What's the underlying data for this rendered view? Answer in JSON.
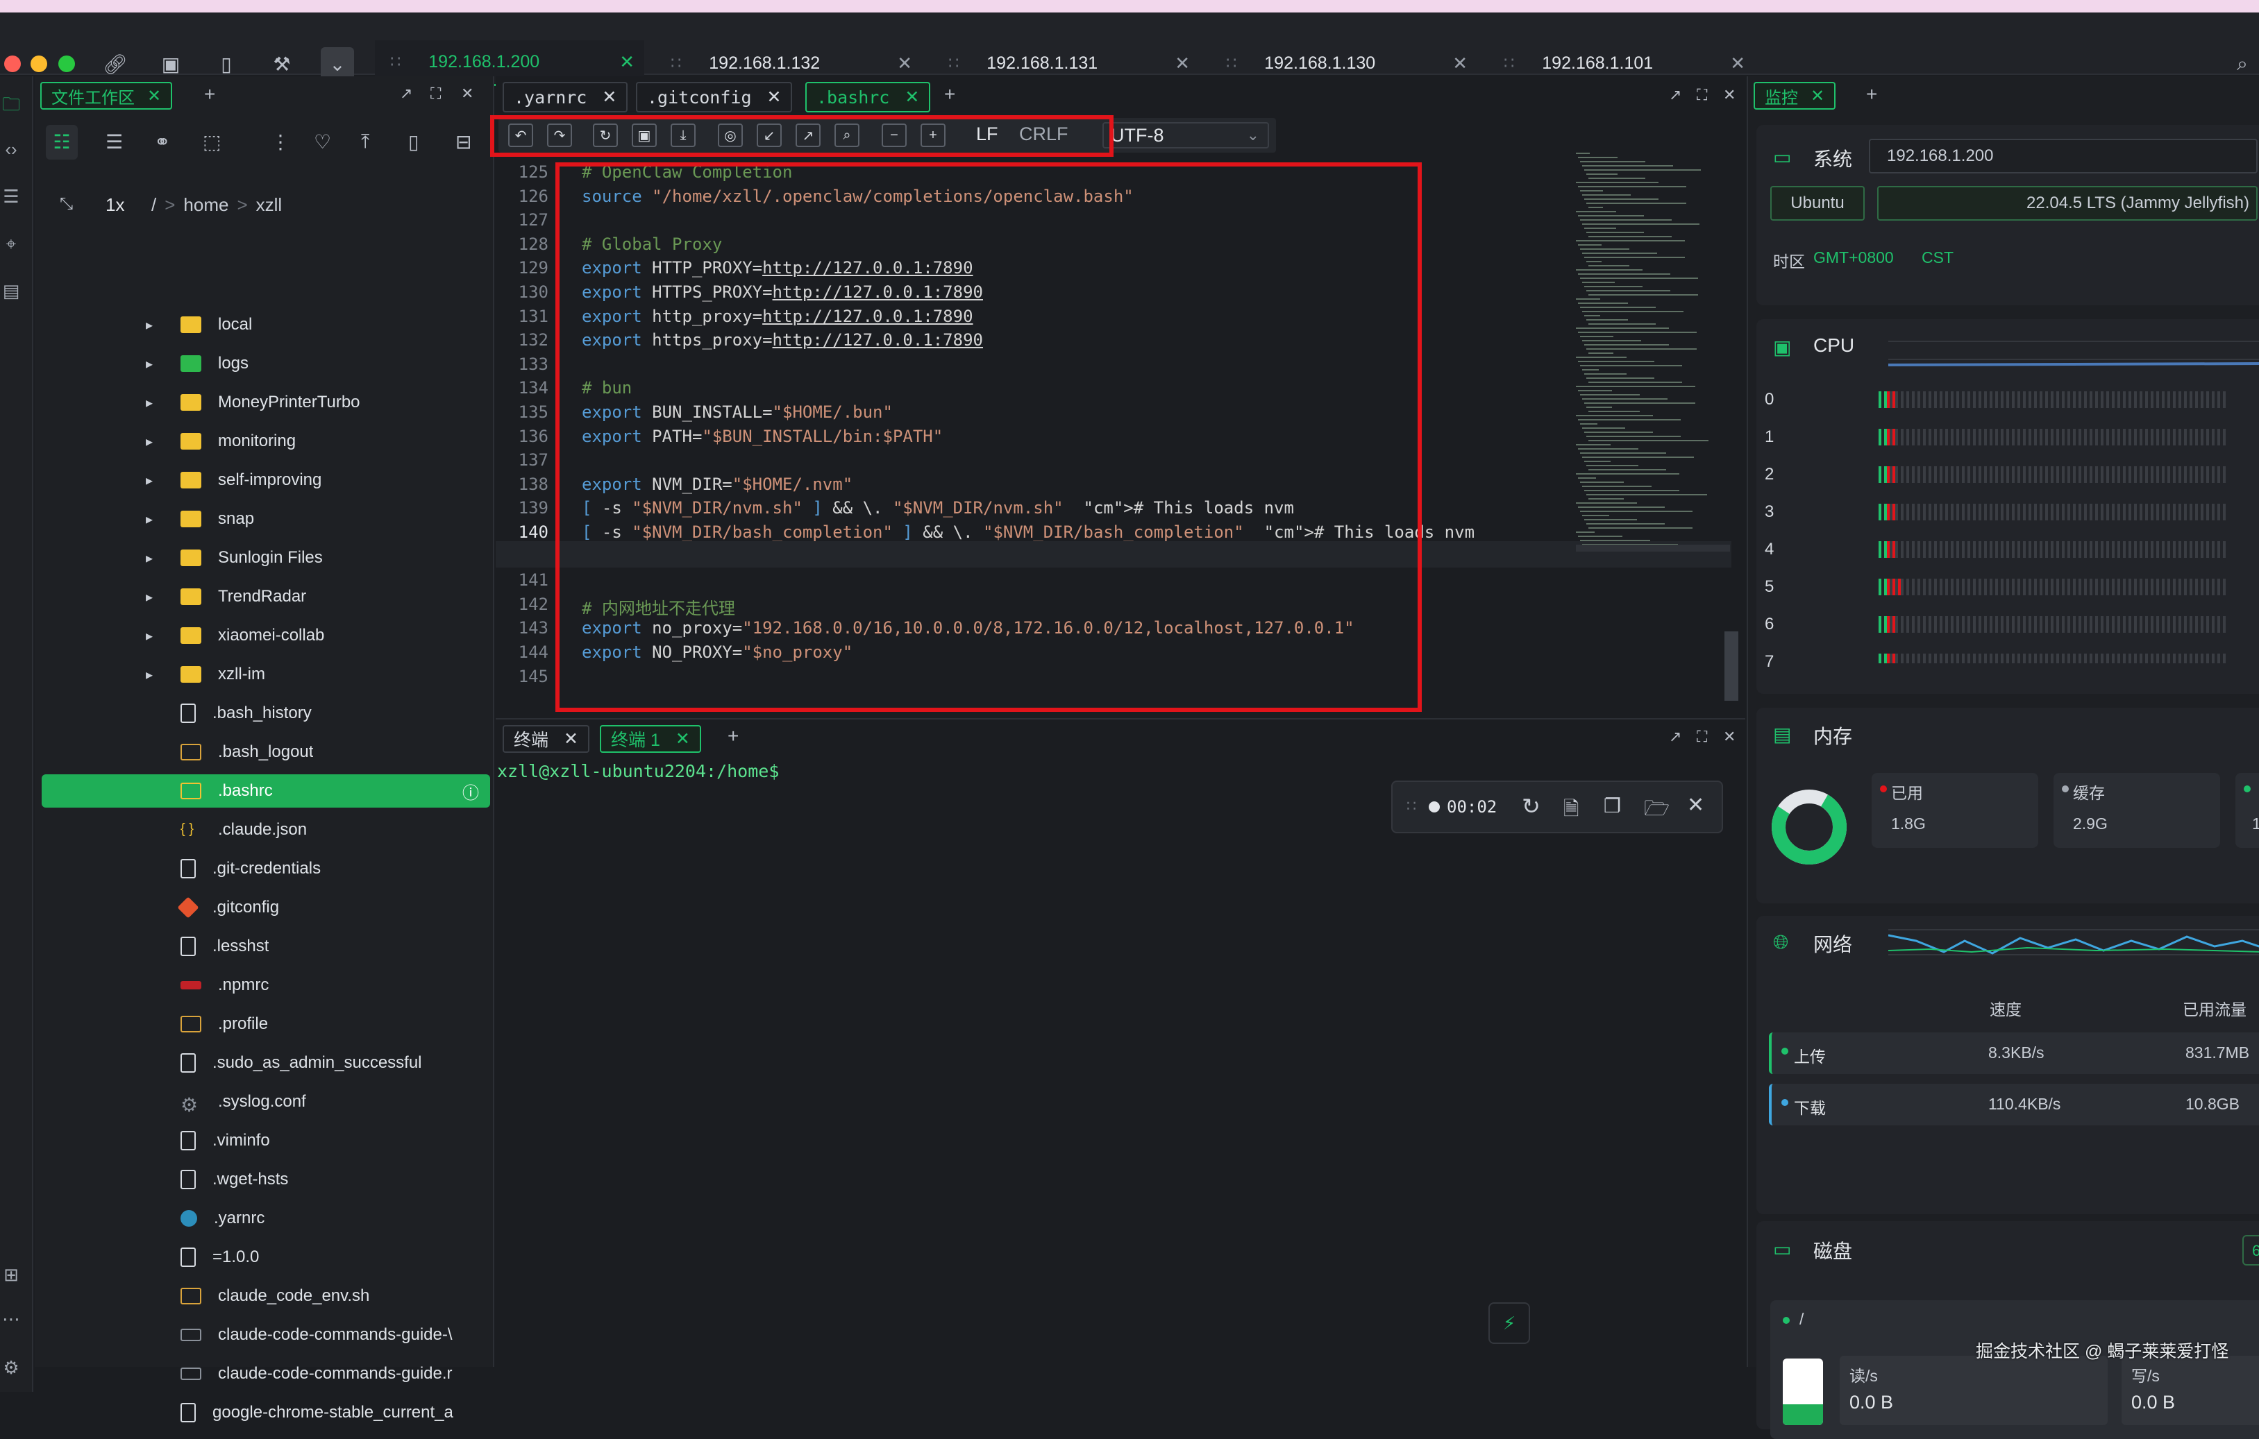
{
  "tabs": [
    {
      "label": "192.168.1.200",
      "active": true
    },
    {
      "label": "192.168.1.132"
    },
    {
      "label": "192.168.1.131"
    },
    {
      "label": "192.168.1.130"
    },
    {
      "label": "192.168.1.101"
    }
  ],
  "file_panel": {
    "tab_label": "文件工作区",
    "zoom": "1x",
    "breadcrumb": [
      "/",
      "home",
      "xzll"
    ],
    "items": [
      {
        "name": "local",
        "type": "folder"
      },
      {
        "name": "logs",
        "type": "folder"
      },
      {
        "name": "MoneyPrinterTurbo",
        "type": "folder"
      },
      {
        "name": "monitoring",
        "type": "folder"
      },
      {
        "name": "self-improving",
        "type": "folder"
      },
      {
        "name": "snap",
        "type": "folder"
      },
      {
        "name": "Sunlogin Files",
        "type": "folder"
      },
      {
        "name": "TrendRadar",
        "type": "folder"
      },
      {
        "name": "xiaomei-collab",
        "type": "folder"
      },
      {
        "name": "xzll-im",
        "type": "folder"
      },
      {
        "name": ".bash_history",
        "type": "file"
      },
      {
        "name": ".bash_logout",
        "type": "terminal"
      },
      {
        "name": ".bashrc",
        "type": "terminal",
        "selected": true
      },
      {
        "name": ".claude.json",
        "type": "json"
      },
      {
        "name": ".git-credentials",
        "type": "file"
      },
      {
        "name": ".gitconfig",
        "type": "git"
      },
      {
        "name": ".lesshst",
        "type": "file"
      },
      {
        "name": ".npmrc",
        "type": "npm"
      },
      {
        "name": ".profile",
        "type": "terminal"
      },
      {
        "name": ".sudo_as_admin_successful",
        "type": "file"
      },
      {
        "name": ".syslog.conf",
        "type": "gear"
      },
      {
        "name": ".viminfo",
        "type": "file"
      },
      {
        "name": ".wget-hsts",
        "type": "file"
      },
      {
        "name": ".yarnrc",
        "type": "yarn"
      },
      {
        "name": "=1.0.0",
        "type": "file"
      },
      {
        "name": "claude_code_env.sh",
        "type": "terminal"
      },
      {
        "name": "claude-code-commands-guide-\\",
        "type": "md"
      },
      {
        "name": "claude-code-commands-guide.r",
        "type": "md"
      },
      {
        "name": "google-chrome-stable_current_a",
        "type": "file"
      }
    ]
  },
  "editor": {
    "tabs": [
      ".yarnrc",
      ".gitconfig",
      ".bashrc"
    ],
    "active_tab": ".bashrc",
    "line_ending_lf": "LF",
    "line_ending_crlf": "CRLF",
    "encoding": "UTF-8",
    "lines": [
      {
        "n": "125",
        "text": "# OpenClaw Completion"
      },
      {
        "n": "126",
        "text": "source \"/home/xzll/.openclaw/completions/openclaw.bash\""
      },
      {
        "n": "127",
        "text": ""
      },
      {
        "n": "128",
        "text": "# Global Proxy"
      },
      {
        "n": "129",
        "text": "export HTTP_PROXY=http://127.0.0.1:7890"
      },
      {
        "n": "130",
        "text": "export HTTPS_PROXY=http://127.0.0.1:7890"
      },
      {
        "n": "131",
        "text": "export http_proxy=http://127.0.0.1:7890"
      },
      {
        "n": "132",
        "text": "export https_proxy=http://127.0.0.1:7890"
      },
      {
        "n": "133",
        "text": ""
      },
      {
        "n": "134",
        "text": "# bun"
      },
      {
        "n": "135",
        "text": "export BUN_INSTALL=\"$HOME/.bun\""
      },
      {
        "n": "136",
        "text": "export PATH=\"$BUN_INSTALL/bin:$PATH\""
      },
      {
        "n": "137",
        "text": ""
      },
      {
        "n": "138",
        "text": "export NVM_DIR=\"$HOME/.nvm\""
      },
      {
        "n": "139",
        "text": "[ -s \"$NVM_DIR/nvm.sh\" ] && \\. \"$NVM_DIR/nvm.sh\"  # This loads nvm"
      },
      {
        "n": "140",
        "text": "[ -s \"$NVM_DIR/bash_completion\" ] && \\. \"$NVM_DIR/bash_completion\"  # This loads nvm"
      },
      {
        "n": "",
        "text": "bash_completion"
      },
      {
        "n": "141",
        "text": ""
      },
      {
        "n": "142",
        "text": "# 内网地址不走代理"
      },
      {
        "n": "143",
        "text": "export no_proxy=\"192.168.0.0/16,10.0.0.0/8,172.16.0.0/12,localhost,127.0.0.1\""
      },
      {
        "n": "144",
        "text": "export NO_PROXY=\"$no_proxy\""
      },
      {
        "n": "145",
        "text": ""
      }
    ]
  },
  "terminal": {
    "tabs": [
      "终端",
      "终端 1"
    ],
    "active_tab": "终端 1",
    "prompt": "xzll@xzll-ubuntu2204:/home$",
    "timer": "00:02"
  },
  "monitor": {
    "tab_label": "监控",
    "system": {
      "title": "系统",
      "ip": "192.168.1.200",
      "os": "Ubuntu",
      "version": "22.04.5 LTS (Jammy Jellyfish)",
      "tz_label": "时区",
      "tz_value": "GMT+0800",
      "tz_name": "CST"
    },
    "cpu": {
      "title": "CPU",
      "cores": [
        "0",
        "1",
        "2",
        "3",
        "4",
        "5",
        "6",
        "7"
      ]
    },
    "memory": {
      "title": "内存",
      "used_label": "已用",
      "used_value": "1.8G",
      "cache_label": "缓存",
      "cache_value": "2.9G",
      "third_value": "1"
    },
    "network": {
      "title": "网络",
      "col_speed": "速度",
      "col_total": "已用流量",
      "upload_label": "上传",
      "upload_speed": "8.3KB/s",
      "upload_total": "831.7MB",
      "download_label": "下载",
      "download_speed": "110.4KB/s",
      "download_total": "10.8GB"
    },
    "disk": {
      "title": "磁盘",
      "badge": "6",
      "mount": "/",
      "read_label": "读/s",
      "read_value": "0.0 B",
      "write_label": "写/s",
      "write_value": "0.0 B"
    }
  },
  "watermark": "掘金技术社区 @ 蝎子莱莱爱打怪",
  "colors": {
    "accent": "#1fc16b",
    "highlight": "#e2141a",
    "background": "#1b1d21"
  }
}
